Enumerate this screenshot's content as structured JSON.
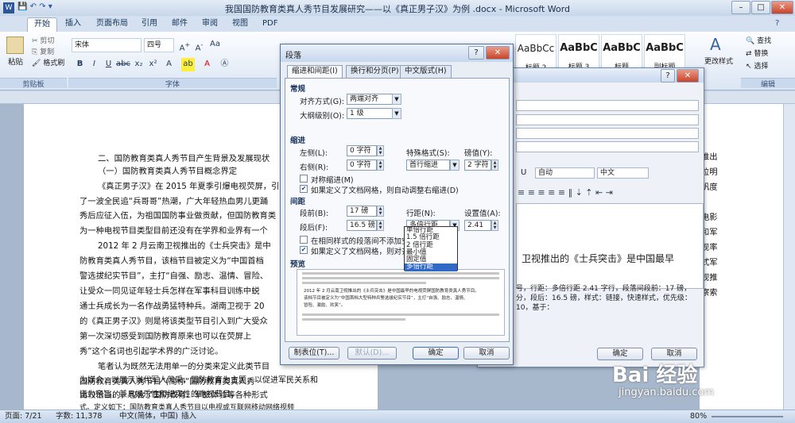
{
  "window": {
    "title": "我国国防教育类真人秀节目发展研究——以《真正男子汉》为例 .docx - Microsoft Word"
  },
  "tabs": [
    "开始",
    "插入",
    "页面布局",
    "引用",
    "邮件",
    "审阅",
    "视图",
    "PDF"
  ],
  "ribbon": {
    "paste": "粘贴",
    "cut": "剪切",
    "copy": "复制",
    "format_painter": "格式刷",
    "clipboard": "剪贴板",
    "font_name": "宋体",
    "font_size": "四号",
    "font_group": "字体",
    "styles": [
      {
        "sample": "AaBbCc",
        "name": "标题 2"
      },
      {
        "sample": "AaBbC",
        "name": "标题 3"
      },
      {
        "sample": "AaBbC",
        "name": "标题"
      },
      {
        "sample": "AaBbC",
        "name": "副标题"
      }
    ],
    "change_styles": "更改样式",
    "find": "查找",
    "replace": "替换",
    "select": "选择",
    "editing": "编辑"
  },
  "document": {
    "lines": [
      "二、国防教育类真人秀节目产生背景及发展现状",
      "（一）国防教育类真人秀节目概念界定",
      "《真正男子汉》在 2015 年夏季引爆电视荧屏，引",
      "了一波全民追“兵哥哥”热潮，广大年轻热血男儿更踊",
      "秀后应征入伍，为祖国国防事业做贡献，但国防教育类",
      "为一种电视节目类型目前还没有在学界和业界有一个",
      "2012 年 2 月云南卫视推出的《士兵突击》是中",
      "防教育类真人秀节目，该档节目被定义为“中国首档",
      "警选拔纪实节目”，主打“自强、励志、温情、冒险、",
      "让受众一同见证年轻士兵怎样在军事科目训练中蜕",
      "通士兵成长为一名作战勇猛特种兵。湖南卫视于 20",
      "的《真正男子汉》则是将该类型节目引入到广大受众",
      "第一次深切感受到国防教育原来也可以在荧屏上",
      "秀”这个名词也引起学术界的广泛讨论。",
      "笔者认为既然无法用单一的分类来定义此类节目",
      "国防教育类真人秀节目”(简称“国防教育类真人秀",
      "比较恰当的，包含了国防教育、军旅体验等各种形式",
      "式。定义如下：国防教育类真人秀节目以电视或互联网移动网络视频",
      "为媒介，以展示当代军人风采，国防教育为主题，以促进军民关系和",
      "谐为宗旨，兼具娱乐性和纪实性的电视节目。"
    ],
    "right_fragments": [
      "推出",
      "位明",
      "帆度",
      "电影",
      "和军",
      "现率",
      "式军",
      "视推",
      "察索"
    ]
  },
  "back_dialog": {
    "fields": [
      "自动",
      "中文"
    ],
    "preview_text": "卫视推出的《士兵突击》是中国最早",
    "desc": "号，行距：多倍行距 2.41 字行，段落间段前：17 磅，分，段后：16.5 磅，样式：链接，快速样式，优先级：10，基于：",
    "ok": "确定",
    "cancel": "取消"
  },
  "dialog": {
    "title": "段落",
    "tabs": [
      "缩进和间距(I)",
      "换行和分页(P)",
      "中文版式(H)"
    ],
    "general": "常规",
    "align_label": "对齐方式(G):",
    "align_value": "两端对齐",
    "outline_label": "大纲级别(O):",
    "outline_value": "1 级",
    "indent": "缩进",
    "left_label": "左侧(L):",
    "left_value": "0 字符",
    "right_label": "右侧(R):",
    "right_value": "0 字符",
    "special_label": "特殊格式(S):",
    "special_value": "首行缩进",
    "by_label": "磅值(Y):",
    "by_value": "2 字符",
    "mirror": "对称缩进(M)",
    "auto_indent": "如果定义了文档网格，则自动调整右缩进(D)",
    "spacing": "间距",
    "before_label": "段前(B):",
    "before_value": "17 磅",
    "after_label": "段后(F):",
    "after_value": "16.5 磅",
    "line_label": "行距(N):",
    "line_value": "多倍行距",
    "at_label": "设置值(A):",
    "at_value": "2.41",
    "no_space": "在相同样式的段落间不添加空格",
    "snap_grid": "如果定义了文档网格，则对齐到",
    "preview": "预览",
    "preview_lines": [
      "2012 年 2 月云南卫视推出的《士兵突击》是中国最早的电视荧屏国防教育类真人秀节目。",
      "该档节目被定义为“中国首档大型特种兵警选拔纪实节目”，主打“自强、励志、温情、",
      "冒险、激励、欢笑”。"
    ],
    "line_options": [
      "单倍行距",
      "1.5 倍行距",
      "2 倍行距",
      "最小值",
      "固定值",
      "多倍行距"
    ],
    "tabs_btn": "制表位(T)...",
    "default_btn": "默认(D)...",
    "ok": "确定",
    "cancel": "取消"
  },
  "status": {
    "page": "页面: 7/21",
    "words": "字数: 11,378",
    "lang": "中文(简体，中国)",
    "mode": "插入",
    "zoom": "80%"
  },
  "watermark": {
    "logo": "Bai 经验",
    "url": "jingyan.baidu.com"
  }
}
